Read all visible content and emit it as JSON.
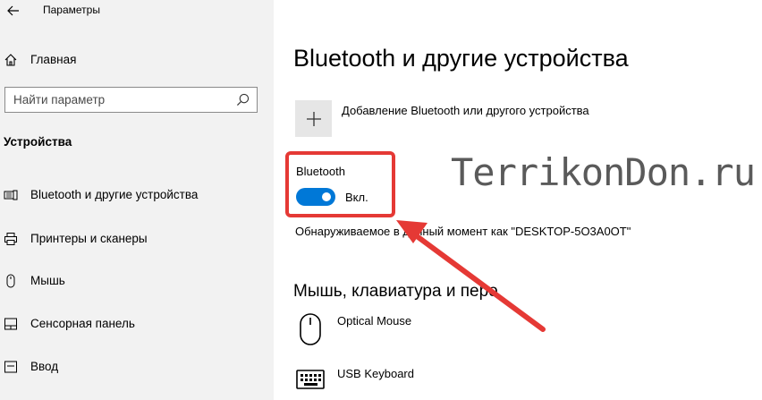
{
  "window": {
    "title": "Параметры"
  },
  "sidebar": {
    "home_label": "Главная",
    "search": {
      "placeholder": "Найти параметр",
      "value": ""
    },
    "section_title": "Устройства",
    "items": [
      {
        "label": "Bluetooth и другие устройства",
        "icon": "bluetooth-devices-icon",
        "selected": true
      },
      {
        "label": "Принтеры и сканеры",
        "icon": "printer-icon",
        "selected": false
      },
      {
        "label": "Мышь",
        "icon": "mouse-icon",
        "selected": false
      },
      {
        "label": "Сенсорная панель",
        "icon": "touchpad-icon",
        "selected": false
      },
      {
        "label": "Ввод",
        "icon": "keyboard-icon",
        "selected": false
      }
    ]
  },
  "main": {
    "title": "Bluetooth и другие устройства",
    "add_device_label": "Добавление Bluetooth или другого устройства",
    "bluetooth": {
      "label": "Bluetooth",
      "state_label": "Вкл.",
      "on": true
    },
    "discoverable_text": "Обнаруживаемое в данный момент как \"DESKTOP-5O3A0OT\"",
    "section2_title": "Мышь, клавиатура и перо",
    "devices": [
      {
        "name": "Optical Mouse",
        "icon": "mouse-icon"
      },
      {
        "name": "USB Keyboard",
        "icon": "keyboard-icon"
      }
    ]
  },
  "overlay": {
    "watermark": "TerrikonDon.ru",
    "highlight_color": "#e53935"
  },
  "colors": {
    "accent": "#0078d7",
    "sidebar_bg": "#f2f2f2"
  }
}
